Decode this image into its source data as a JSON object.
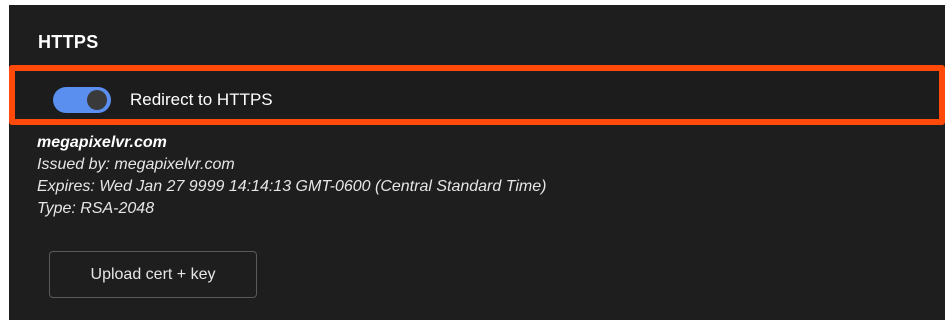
{
  "section": {
    "title": "HTTPS"
  },
  "redirect_toggle": {
    "label": "Redirect to HTTPS",
    "enabled": true,
    "highlight_color": "#ff4a0a",
    "on_color": "#5a8ff0"
  },
  "certificate": {
    "domain": "megapixelvr.com",
    "issued_by": "Issued by: megapixelvr.com",
    "expires": "Expires: Wed Jan 27 9999 14:14:13 GMT-0600 (Central Standard Time)",
    "type": "Type: RSA-2048"
  },
  "actions": {
    "upload_label": "Upload cert + key"
  }
}
